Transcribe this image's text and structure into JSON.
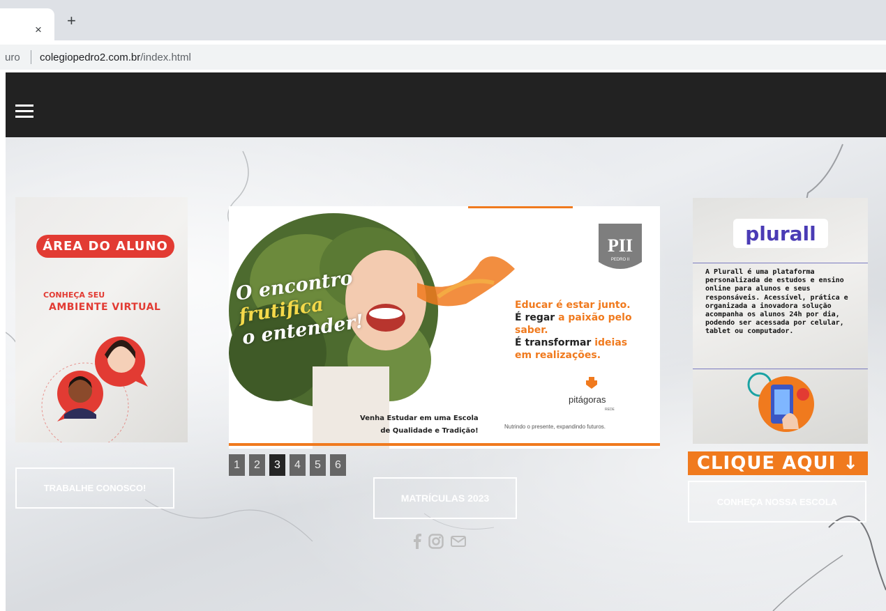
{
  "browser": {
    "tab_close": "×",
    "new_tab": "+",
    "url_prefix": "uro",
    "url_domain": "colegiopedro2.com.br",
    "url_path": "/index.html"
  },
  "nav": {
    "menu_icon": "hamburger-menu-icon"
  },
  "left_card": {
    "banner": "ÁREA DO ALUNO",
    "line1": "CONHEÇA SEU",
    "line2": "AMBIENTE VIRTUAL"
  },
  "slider": {
    "script_line1": "O encontro",
    "script_line2": "frutifica",
    "script_line3": "o entender!",
    "tagline_1": "Educar é estar junto.",
    "tagline_2a": "É regar ",
    "tagline_2b": "a paixão pelo saber.",
    "tagline_3a": "É transformar ",
    "tagline_3b": "ideias",
    "tagline_4": "em realizações.",
    "venha_1": "Venha Estudar em uma Escola",
    "venha_2": "de Qualidade e Tradição!",
    "brand": "pitágoras",
    "brand_small": "REDE",
    "footer": "Nutrindo o presente, expandindo futuros.",
    "crest_text": "PII",
    "crest_label": "PEDRO II",
    "pages": [
      "1",
      "2",
      "3",
      "4",
      "5",
      "6"
    ],
    "active_page": "3"
  },
  "right_card": {
    "logo": "plurall",
    "description": "A Plurall é uma plataforma personalizada de estudos e ensino online para alunos e seus responsáveis. Acessível, prática e organizada a inovadora solução acompanha os alunos 24h por dia, podendo ser acessada por celular, tablet ou computador."
  },
  "buttons": {
    "clique": "CLIQUE AQUI ↓",
    "trabalhe": "TRABALHE CONOSCO!",
    "matriculas": "MATRÍCULAS 2023",
    "conheca": "CONHEÇA NOSSA ESCOLA"
  },
  "social": [
    "facebook-icon",
    "instagram-icon",
    "mail-icon"
  ],
  "colors": {
    "accent": "#f07a1e",
    "red": "#e23b33",
    "nav": "#222222",
    "plurall": "#4a3bb5"
  }
}
